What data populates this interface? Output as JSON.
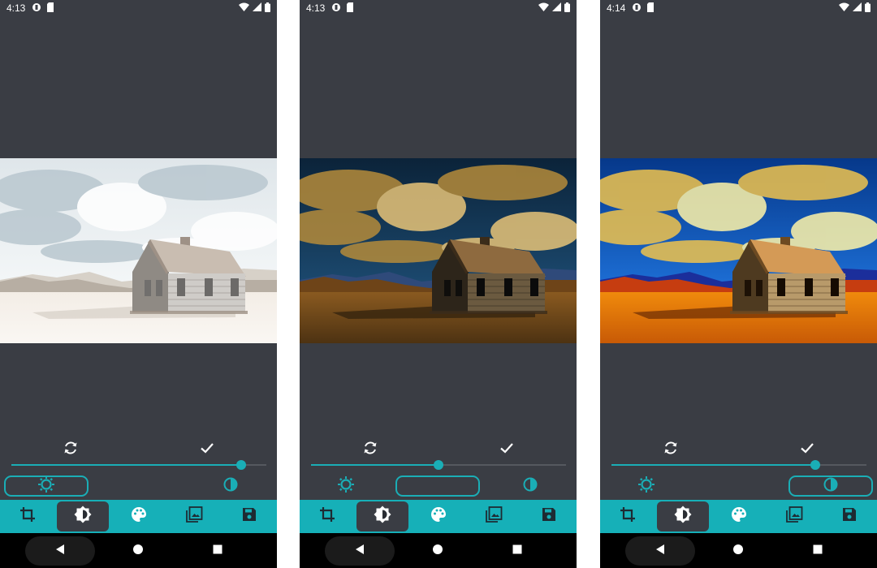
{
  "colors": {
    "background": "#3a3d44",
    "accent": "#1aaeb6",
    "toolbar": "#16b0b8",
    "icon_dark": "#1e2b33",
    "nav_bar": "#000000"
  },
  "icons": {
    "status": [
      "data-saver-icon",
      "sd-card-icon",
      "wifi-icon",
      "cell-signal-icon",
      "battery-icon"
    ],
    "action_row": [
      "reset-icon",
      "check-icon"
    ],
    "adjustments": [
      "brightness-icon",
      "moon-icon",
      "contrast-icon"
    ],
    "tools": [
      "crop-icon",
      "brightness-contrast-icon",
      "palette-icon",
      "gallery-icon",
      "save-icon"
    ],
    "nav": [
      "back-icon",
      "home-icon",
      "recents-icon"
    ]
  },
  "screens": [
    {
      "time": "4:13",
      "image_variant": "washed-out",
      "slider_value": 0.9,
      "selected_adjustment": "brightness",
      "active_tool": "brightness-contrast"
    },
    {
      "time": "4:13",
      "image_variant": "dark",
      "slider_value": 0.5,
      "selected_adjustment": "darkness",
      "active_tool": "brightness-contrast"
    },
    {
      "time": "4:14",
      "image_variant": "vivid",
      "slider_value": 0.8,
      "selected_adjustment": "contrast",
      "active_tool": "brightness-contrast"
    }
  ]
}
